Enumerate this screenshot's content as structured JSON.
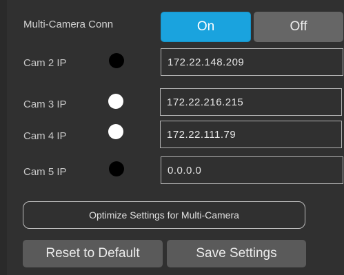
{
  "multi_camera": {
    "label": "Multi-Camera Conn",
    "on_label": "On",
    "off_label": "Off",
    "selected": "On",
    "active_color": "#1aa3de",
    "inactive_color": "#666666"
  },
  "cameras": [
    {
      "label": "Cam 2 IP",
      "ip": "172.22.148.209",
      "status": "disconnected",
      "dot_color": "#000000"
    },
    {
      "label": "Cam 3 IP",
      "ip": "172.22.216.215",
      "status": "connected",
      "dot_color": "#ffffff"
    },
    {
      "label": "Cam 4 IP",
      "ip": "172.22.111.79",
      "status": "connected",
      "dot_color": "#ffffff"
    },
    {
      "label": "Cam 5 IP",
      "ip": "0.0.0.0",
      "status": "disconnected",
      "dot_color": "#000000"
    }
  ],
  "actions": {
    "optimize_label": "Optimize Settings for Multi-Camera",
    "reset_label": "Reset to Default",
    "save_label": "Save Settings"
  }
}
